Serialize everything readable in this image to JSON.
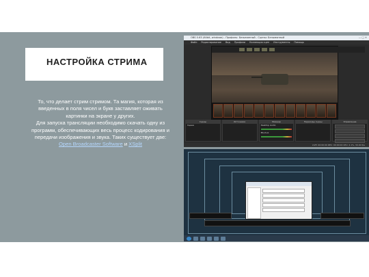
{
  "slide": {
    "title": "НАСТРОЙКА СТРИМА",
    "paragraph_1": "То, что делает стрим стримом. Та магия, которая из введенных в поля чисел и букв заставляет оживать картинки на экране у других.",
    "paragraph_2_before_links": "Для запуска трансляции необходимо скачать одну из программ, обеспечивающих весь процесс кодирования и передачи изображения и звука. Таких существует две:",
    "link_1": "Open Broadcaster Software",
    "link_conjunction": " и ",
    "link_2": "XSplit"
  },
  "obs_window": {
    "title": "OBS 0.63 (64bit, windows) - Профиль: Безымянный - Сцены: Безымянный",
    "window_controls": "— □ ✕",
    "menu": [
      "Файл",
      "Редактирование",
      "Вид",
      "Профили",
      "Коллекция сцен",
      "Инструменты",
      "Помощь"
    ],
    "panels": [
      {
        "header": "Сцены",
        "rows": [
          "Сцена"
        ]
      },
      {
        "header": "Источники",
        "rows": []
      },
      {
        "header": "Микшер",
        "rows": [
          "Desktop Audio",
          "Mic/Aux"
        ]
      },
      {
        "header": "Переходы сцены",
        "rows": []
      },
      {
        "header": "Управление",
        "rows": []
      }
    ],
    "control_buttons": 6,
    "status": "LIVE: 00:00:00   REC: 00:00:00   CPU: 2.1%, 30.00 fps"
  },
  "colors": {
    "band": "#8d9a9e",
    "title_card": "#ffffff",
    "link": "#b6d8ff"
  }
}
